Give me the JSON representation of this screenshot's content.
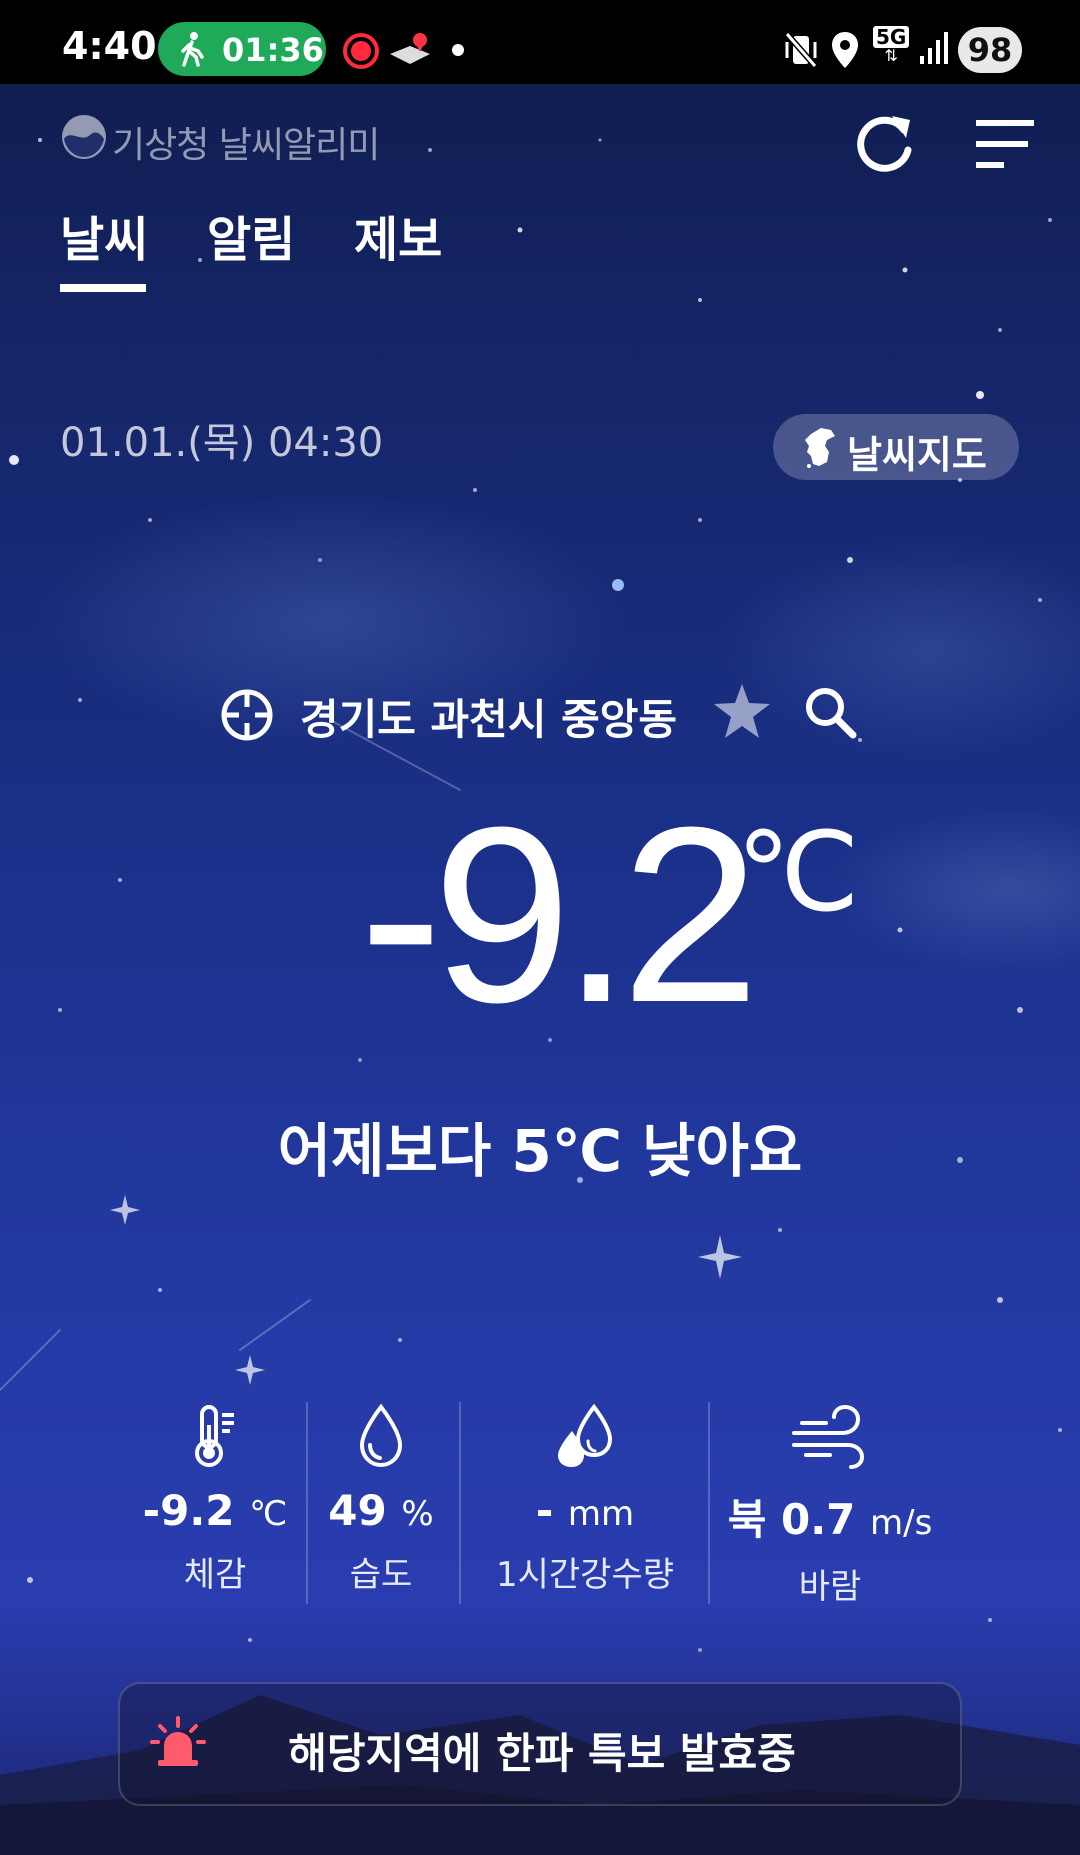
{
  "status_bar": {
    "time": "4:40",
    "activity_timer": "01:36",
    "network": "5G",
    "battery": "98"
  },
  "header": {
    "app_title": "기상청 날씨알리미"
  },
  "tabs": [
    {
      "label": "날씨",
      "active": true
    },
    {
      "label": "알림",
      "active": false
    },
    {
      "label": "제보",
      "active": false
    }
  ],
  "main": {
    "datetime": "01.01.(목) 04:30",
    "map_button": "날씨지도",
    "location": "경기도 과천시 중앙동",
    "temperature": "-9.2",
    "temperature_unit": "℃",
    "comparison": "어제보다 5℃ 낮아요"
  },
  "stats": [
    {
      "value": "-9.2",
      "unit": "℃",
      "label": "체감",
      "icon": "thermometer-icon"
    },
    {
      "value": "49",
      "unit": "%",
      "label": "습도",
      "icon": "humidity-drop-icon"
    },
    {
      "value": "-",
      "unit": "mm",
      "label": "1시간강수량",
      "icon": "rain-drops-icon"
    },
    {
      "value": "북 0.7",
      "unit": "m/s",
      "label": "바람",
      "icon": "wind-icon"
    }
  ],
  "alert": {
    "text": "해당지역에 한파 특보 발효중",
    "icon": "siren-icon"
  },
  "colors": {
    "status_pill": "#1faa5a",
    "siren": "#ff5a6e",
    "background_deep": "#142463"
  }
}
